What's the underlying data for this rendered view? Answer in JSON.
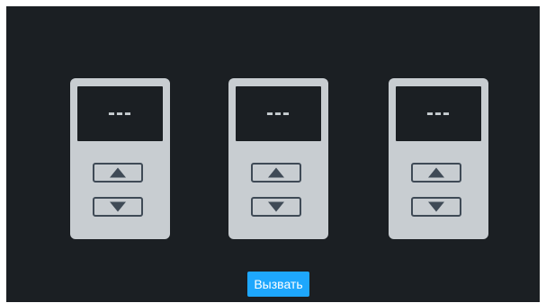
{
  "devices": [
    {
      "display": "---"
    },
    {
      "display": "---"
    },
    {
      "display": "---"
    }
  ],
  "icons": {
    "up": "triangle-up-icon",
    "down": "triangle-down-icon"
  },
  "call_button": {
    "label": "Вызвать"
  },
  "colors": {
    "background": "#1b1f23",
    "device_body": "#c8cdd1",
    "button_outline": "#3f4a56",
    "accent": "#1ea7fd"
  }
}
